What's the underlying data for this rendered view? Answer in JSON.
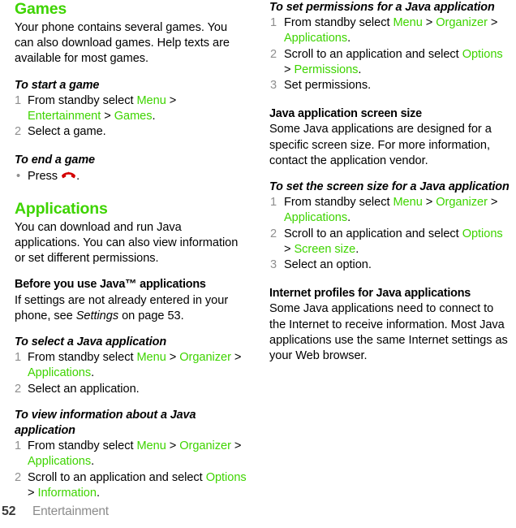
{
  "document": {
    "page_number": "52",
    "chapter": "Entertainment",
    "accent_color": "#3ed400",
    "step_number_color": "#8f8f8f",
    "icon_color": "#d40000"
  },
  "left_column": {
    "heading": "Games",
    "intro": "Your phone contains several games. You can also download games. Help texts are available for most games.",
    "task_start": {
      "title": "To start a game",
      "steps": [
        {
          "num": "1",
          "parts": [
            {
              "t": "From standby select ",
              "s": "plain"
            },
            {
              "t": "Menu",
              "s": "menu"
            },
            {
              "t": " > ",
              "s": "plain"
            },
            {
              "t": "Entertainment",
              "s": "menu"
            },
            {
              "t": " > ",
              "s": "plain"
            },
            {
              "t": "Games",
              "s": "menu"
            },
            {
              "t": ".",
              "s": "plain"
            }
          ]
        },
        {
          "num": "2",
          "parts": [
            {
              "t": "Select a game.",
              "s": "plain"
            }
          ]
        }
      ]
    },
    "task_end": {
      "title": "To end a game",
      "bullet_prefix": "Press ",
      "bullet_icon": "end-call-icon",
      "bullet_suffix": "."
    },
    "heading2": "Applications",
    "intro2": "You can download and run Java applications. You can also view information or set different permissions.",
    "before_java": {
      "title": "Before you use Java™ applications",
      "text_before": "If settings are not already entered in your phone, see ",
      "text_italic": "Settings",
      "text_after": " on page 53."
    },
    "task_select": {
      "title": "To select a Java application",
      "steps": [
        {
          "num": "1",
          "parts": [
            {
              "t": "From standby select ",
              "s": "plain"
            },
            {
              "t": "Menu",
              "s": "menu"
            },
            {
              "t": " > ",
              "s": "plain"
            },
            {
              "t": "Organizer",
              "s": "menu"
            },
            {
              "t": " > ",
              "s": "plain"
            },
            {
              "t": "Applications",
              "s": "menu"
            },
            {
              "t": ".",
              "s": "plain"
            }
          ]
        },
        {
          "num": "2",
          "parts": [
            {
              "t": "Select an application.",
              "s": "plain"
            }
          ]
        }
      ]
    },
    "task_view_info": {
      "title": "To view information about a Java application",
      "steps": [
        {
          "num": "1",
          "parts": [
            {
              "t": "From standby select ",
              "s": "plain"
            },
            {
              "t": "Menu",
              "s": "menu"
            },
            {
              "t": " > ",
              "s": "plain"
            },
            {
              "t": "Organizer",
              "s": "menu"
            },
            {
              "t": " > ",
              "s": "plain"
            },
            {
              "t": "Applications",
              "s": "menu"
            },
            {
              "t": ".",
              "s": "plain"
            }
          ]
        },
        {
          "num": "2",
          "parts": [
            {
              "t": "Scroll to an application and select ",
              "s": "plain"
            },
            {
              "t": "Options",
              "s": "menu"
            },
            {
              "t": " > ",
              "s": "plain"
            },
            {
              "t": "Information",
              "s": "menu"
            },
            {
              "t": ".",
              "s": "plain"
            }
          ]
        }
      ]
    }
  },
  "right_column": {
    "task_permissions": {
      "title": "To set permissions for a Java application",
      "steps": [
        {
          "num": "1",
          "parts": [
            {
              "t": "From standby select ",
              "s": "plain"
            },
            {
              "t": "Menu",
              "s": "menu"
            },
            {
              "t": " > ",
              "s": "plain"
            },
            {
              "t": "Organizer",
              "s": "menu"
            },
            {
              "t": " > ",
              "s": "plain"
            },
            {
              "t": "Applications",
              "s": "menu"
            },
            {
              "t": ".",
              "s": "plain"
            }
          ]
        },
        {
          "num": "2",
          "parts": [
            {
              "t": "Scroll to an application and select ",
              "s": "plain"
            },
            {
              "t": "Options",
              "s": "menu"
            },
            {
              "t": " > ",
              "s": "plain"
            },
            {
              "t": "Permissions",
              "s": "menu"
            },
            {
              "t": ".",
              "s": "plain"
            }
          ]
        },
        {
          "num": "3",
          "parts": [
            {
              "t": "Set permissions.",
              "s": "plain"
            }
          ]
        }
      ]
    },
    "screen_size": {
      "title": "Java application screen size",
      "text": "Some Java applications are designed for a specific screen size. For more information, contact the application vendor."
    },
    "task_screen_size": {
      "title": "To set the screen size for a Java application",
      "steps": [
        {
          "num": "1",
          "parts": [
            {
              "t": "From standby select ",
              "s": "plain"
            },
            {
              "t": "Menu",
              "s": "menu"
            },
            {
              "t": " > ",
              "s": "plain"
            },
            {
              "t": "Organizer",
              "s": "menu"
            },
            {
              "t": " > ",
              "s": "plain"
            },
            {
              "t": "Applications",
              "s": "menu"
            },
            {
              "t": ".",
              "s": "plain"
            }
          ]
        },
        {
          "num": "2",
          "parts": [
            {
              "t": "Scroll to an application and select ",
              "s": "plain"
            },
            {
              "t": "Options",
              "s": "menu"
            },
            {
              "t": " > ",
              "s": "plain"
            },
            {
              "t": "Screen size",
              "s": "menu"
            },
            {
              "t": ".",
              "s": "plain"
            }
          ]
        },
        {
          "num": "3",
          "parts": [
            {
              "t": "Select an option.",
              "s": "plain"
            }
          ]
        }
      ]
    },
    "internet_profiles": {
      "title": "Internet profiles for Java applications",
      "text": "Some Java applications need to connect to the Internet to receive information. Most Java applications use the same Internet settings as your Web browser."
    }
  }
}
